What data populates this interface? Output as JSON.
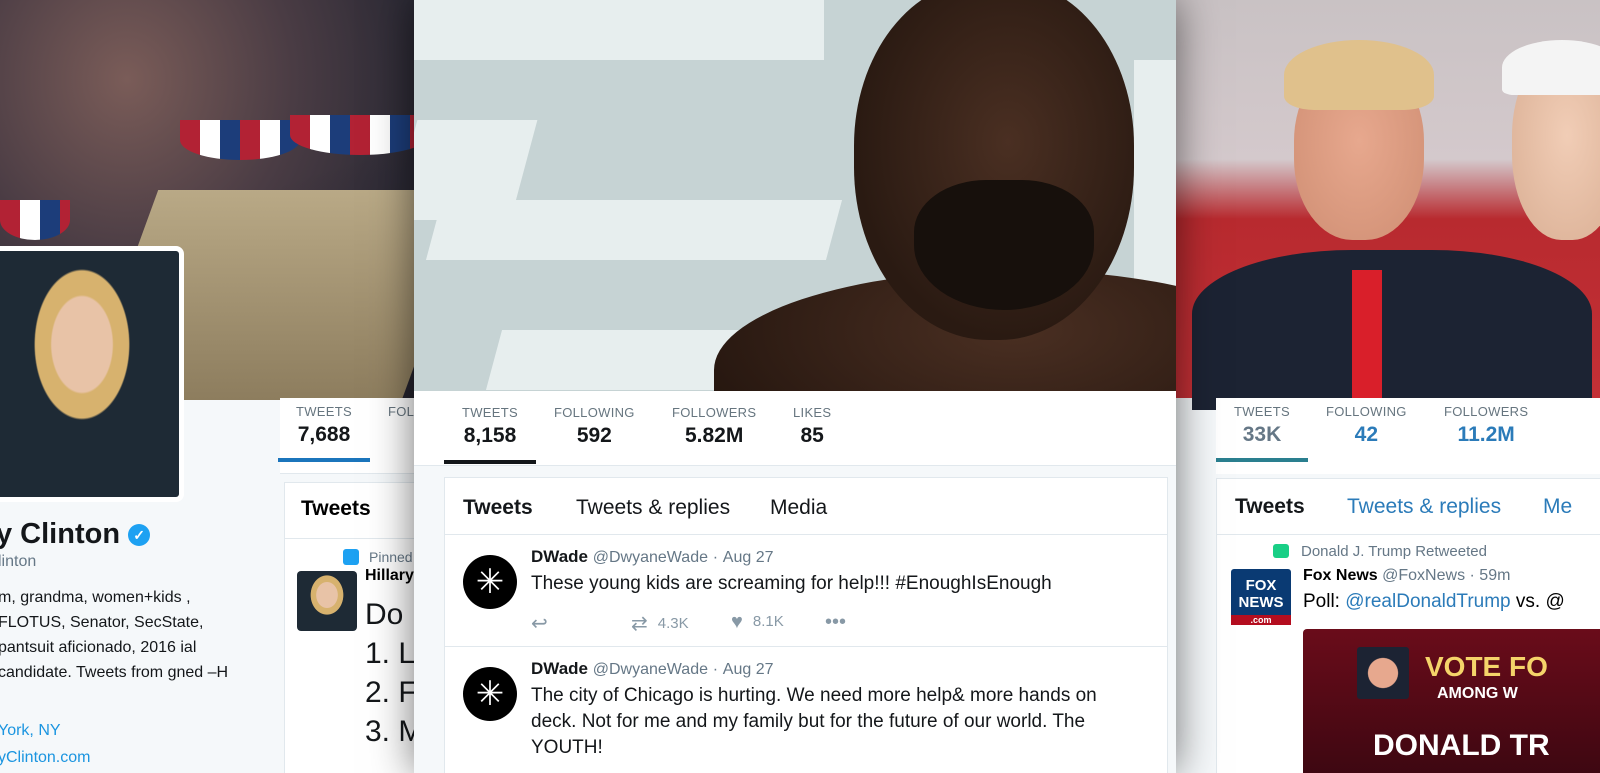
{
  "left_profile": {
    "stats": [
      {
        "label": "TWEETS",
        "value": "7,688"
      },
      {
        "label": "FOL",
        "value": ""
      }
    ],
    "name": "y Clinton",
    "handle": "linton",
    "bio": "m, grandma, women+kids , FLOTUS, Senator, SecState, pantsuit aficionado, 2016 ial candidate. Tweets from gned –H",
    "location": "York, NY",
    "url": "yClinton.com",
    "timeline": {
      "tab": "Tweets",
      "pinned_label": "Pinned",
      "author": "Hillary",
      "big_text_lines": [
        "Do",
        "1. L",
        "2. F",
        "3. M"
      ]
    }
  },
  "center_profile": {
    "stats": [
      {
        "label": "TWEETS",
        "value": "8,158"
      },
      {
        "label": "FOLLOWING",
        "value": "592"
      },
      {
        "label": "FOLLOWERS",
        "value": "5.82M"
      },
      {
        "label": "LIKES",
        "value": "85"
      }
    ],
    "tabs": [
      "Tweets",
      "Tweets & replies",
      "Media"
    ],
    "tweets": [
      {
        "author": "DWade",
        "handle": "@DwyaneWade",
        "date": "Aug 27",
        "text": "These young kids are screaming for help!!! #EnoughIsEnough",
        "retweets": "4.3K",
        "likes": "8.1K"
      },
      {
        "author": "DWade",
        "handle": "@DwyaneWade",
        "date": "Aug 27",
        "text": "The city of Chicago is hurting. We need more help& more hands on deck. Not for me and my family but for the future of our world. The YOUTH!"
      }
    ]
  },
  "right_profile": {
    "stats": [
      {
        "label": "TWEETS",
        "value": "33K"
      },
      {
        "label": "FOLLOWING",
        "value": "42"
      },
      {
        "label": "FOLLOWERS",
        "value": "11.2M"
      }
    ],
    "tabs": [
      "Tweets",
      "Tweets & replies",
      "Me"
    ],
    "retweeted_label": "Donald J. Trump Retweeted",
    "tweet": {
      "author": "Fox News",
      "handle": "@FoxNews",
      "time": "59m",
      "text_prefix": "Poll: ",
      "mention": "@realDonaldTrump",
      "text_suffix": " vs. @",
      "logo_text": "FOX NEWS",
      "logo_sub": ".com",
      "media_text_1": "VOTE FO",
      "media_text_2": "AMONG W",
      "media_text_3": "DONALD TR"
    }
  },
  "colors": {
    "accent_blue": "#1da1f2",
    "link_blue": "#1b95e0",
    "trump_accent": "#2b7bb9",
    "trump_underline": "#2a7f8f",
    "clinton_underline": "#1b75bc"
  },
  "icons": [
    "verified-badge-icon",
    "pin-icon",
    "retweet-icon",
    "reply-icon",
    "heart-icon",
    "more-icon",
    "dwade-logo-icon"
  ]
}
